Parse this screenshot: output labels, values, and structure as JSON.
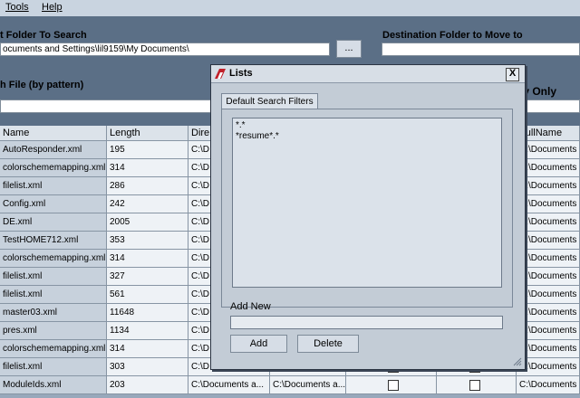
{
  "menu": {
    "tools": "Tools",
    "help": "Help"
  },
  "source": {
    "label": "t Folder To Search",
    "path": "ocuments and Settings\\lil9159\\My Documents\\",
    "browse_label": "..."
  },
  "destination": {
    "label": "Destination Folder to Move to",
    "path": ""
  },
  "search": {
    "label": "h File (by pattern)",
    "value": ""
  },
  "right_label": "py Only",
  "grid": {
    "headers": [
      "Name",
      "Length",
      "Dire",
      "",
      "",
      "",
      "FullName"
    ],
    "rows": [
      {
        "name": "AutoResponder.xml",
        "length": "195",
        "dir": "C:\\D",
        "dir2": "",
        "full": "C:\\Documents a"
      },
      {
        "name": "colorschememapping.xml",
        "length": "314",
        "dir": "C:\\D",
        "dir2": "",
        "full": "C:\\Documents a"
      },
      {
        "name": "filelist.xml",
        "length": "286",
        "dir": "C:\\D",
        "dir2": "",
        "full": "C:\\Documents a"
      },
      {
        "name": "Config.xml",
        "length": "242",
        "dir": "C:\\D",
        "dir2": "",
        "full": "C:\\Documents a"
      },
      {
        "name": "DE.xml",
        "length": "2005",
        "dir": "C:\\D",
        "dir2": "",
        "full": "C:\\Documents a"
      },
      {
        "name": "TestHOME712.xml",
        "length": "353",
        "dir": "C:\\D",
        "dir2": "",
        "full": "C:\\Documents a"
      },
      {
        "name": "colorschememapping.xml",
        "length": "314",
        "dir": "C:\\D",
        "dir2": "",
        "full": "C:\\Documents a"
      },
      {
        "name": "filelist.xml",
        "length": "327",
        "dir": "C:\\D",
        "dir2": "",
        "full": "C:\\Documents a"
      },
      {
        "name": "filelist.xml",
        "length": "561",
        "dir": "C:\\D",
        "dir2": "",
        "full": "C:\\Documents a"
      },
      {
        "name": "master03.xml",
        "length": "11648",
        "dir": "C:\\D",
        "dir2": "",
        "full": "C:\\Documents a"
      },
      {
        "name": "pres.xml",
        "length": "1134",
        "dir": "C:\\D",
        "dir2": "",
        "full": "C:\\Documents a"
      },
      {
        "name": "colorschememapping.xml",
        "length": "314",
        "dir": "C:\\D",
        "dir2": "",
        "full": "C:\\Documents a"
      },
      {
        "name": "filelist.xml",
        "length": "303",
        "dir": "C:\\D",
        "dir2": "",
        "full": "C:\\Documents a"
      },
      {
        "name": "ModuleIds.xml",
        "length": "203",
        "dir": "C:\\Documents a...",
        "dir2": "C:\\Documents a...",
        "full": "C:\\Documents a"
      }
    ]
  },
  "dialog": {
    "title": "Lists",
    "close_label": "X",
    "tab_label": "Default Search Filters",
    "filters": [
      "*.*",
      "*resume*.*"
    ],
    "add_new_label": "Add New",
    "add_new_value": "",
    "add_button": "Add",
    "delete_button": "Delete"
  },
  "colors": {
    "background": "#5b6f86",
    "dialog": "#c3ccd6",
    "icon_red": "#c0202a"
  }
}
